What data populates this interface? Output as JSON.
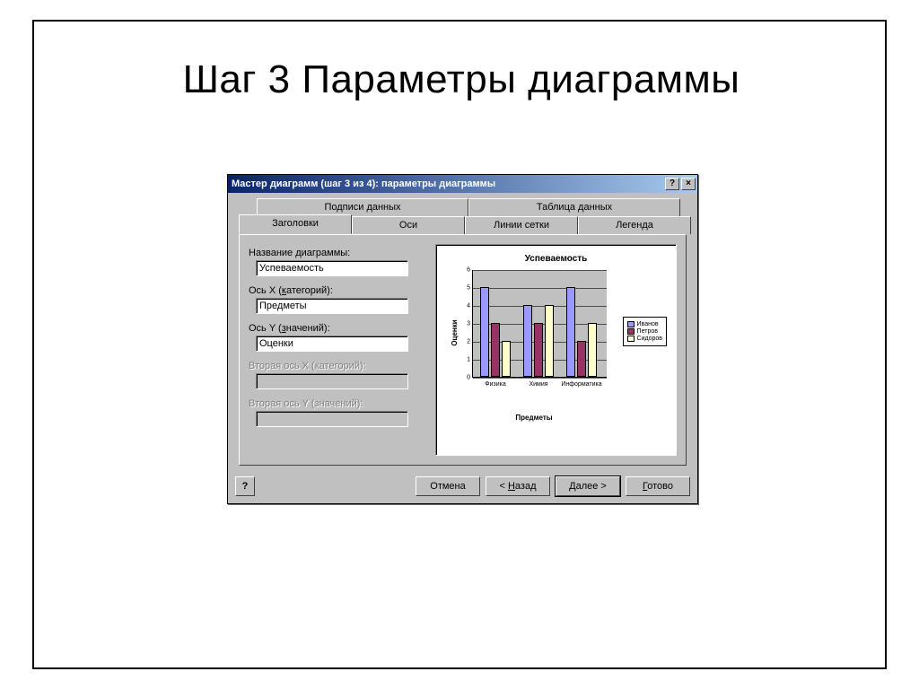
{
  "slide": {
    "title": "Шаг 3 Параметры диаграммы"
  },
  "window": {
    "title": "Мастер диаграмм (шаг 3 из 4): параметры диаграммы",
    "help_btn": "?",
    "close_btn": "×"
  },
  "tabs": {
    "data_labels": "Подписи данных",
    "data_table": "Таблица данных",
    "titles": "Заголовки",
    "axes": "Оси",
    "gridlines": "Линии сетки",
    "legend": "Легенда"
  },
  "form": {
    "chart_title_label_pre": "Название ",
    "chart_title_label_key": "д",
    "chart_title_label_post": "иаграммы:",
    "chart_title_value": "Успеваемость",
    "x_label_pre": "Ось X (",
    "x_label_key": "к",
    "x_label_post": "атегорий):",
    "x_value": "Предметы",
    "y_label_pre": "Ось Y (",
    "y_label_key": "з",
    "y_label_post": "начений):",
    "y_value": "Оценки",
    "x2_label": "Вторая ось X (категорий):",
    "x2_value": "",
    "y2_label": "Вторая ось Y (значений):",
    "y2_value": ""
  },
  "buttons": {
    "help": "?",
    "cancel": "Отмена",
    "back_pre": "< ",
    "back_key": "Н",
    "back_post": "азад",
    "next_pre": "",
    "next_key": "Д",
    "next_post": "алее >",
    "finish_pre": "",
    "finish_key": "Г",
    "finish_post": "отово"
  },
  "chart_data": {
    "type": "bar",
    "title": "Успеваемость",
    "xlabel": "Предметы",
    "ylabel": "Оценки",
    "ylim": [
      0,
      6
    ],
    "yticks": [
      0,
      1,
      2,
      3,
      4,
      5,
      6
    ],
    "categories": [
      "Физика",
      "Химия",
      "Информатика"
    ],
    "series": [
      {
        "name": "Иванов",
        "values": [
          5,
          4,
          5
        ]
      },
      {
        "name": "Петров",
        "values": [
          3,
          3,
          2
        ]
      },
      {
        "name": "Сидоров",
        "values": [
          2,
          4,
          3
        ]
      }
    ],
    "colors": {
      "Иванов": "#9999ff",
      "Петров": "#993366",
      "Сидоров": "#ffffcc"
    }
  }
}
